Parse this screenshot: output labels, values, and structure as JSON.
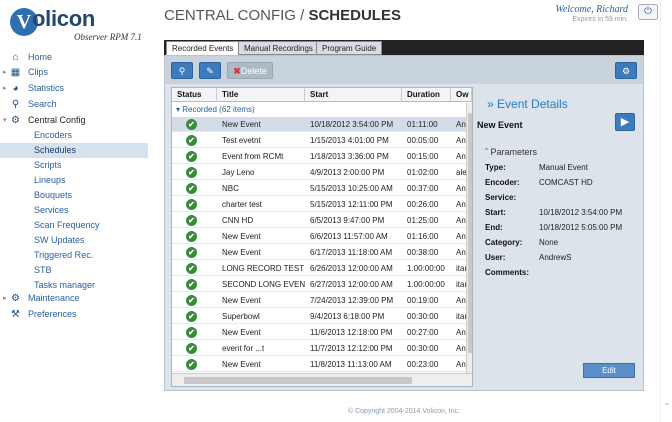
{
  "logo": {
    "word": "olicon",
    "letter": "V",
    "subtitle": "Observer RPM 7.1"
  },
  "header": {
    "title_prefix": "CENTRAL CONFIG / ",
    "title_bold": "SCHEDULES",
    "welcome": "Welcome, Richard",
    "expires": "Expires in 59 min."
  },
  "sidebar": {
    "items": [
      {
        "label": "Home",
        "icon": "home-icon"
      },
      {
        "label": "Clips",
        "icon": "clips-icon"
      },
      {
        "label": "Statistics",
        "icon": "statistics-icon"
      },
      {
        "label": "Search",
        "icon": "search-icon"
      },
      {
        "label": "Central Config",
        "icon": "gear-icon"
      }
    ],
    "subitems": [
      "Encoders",
      "Schedules",
      "Scripts",
      "Lineups",
      "Bouquets",
      "Services",
      "Scan Frequency",
      "SW Updates",
      "Triggered Rec.",
      "STB",
      "Tasks manager"
    ],
    "bottom": [
      {
        "label": "Maintenance",
        "icon": "maintenance-icon"
      },
      {
        "label": "Preferences",
        "icon": "wrench-icon"
      }
    ]
  },
  "tabs": [
    "Recorded Events",
    "Manual Recordings",
    "Program Guide"
  ],
  "toolbar": {
    "delete_label": "Delete"
  },
  "grid": {
    "headers": [
      "Status",
      "Title",
      "Start",
      "Duration",
      "Ow"
    ],
    "group_label": "Recorded (62 items)",
    "rows": [
      {
        "title": "New Event",
        "start": "10/18/2012 3:54:00 PM",
        "duration": "01:11:00",
        "owner": "An"
      },
      {
        "title": "Test evetnt",
        "start": "1/15/2013 4:01:00 PM",
        "duration": "00:05:00",
        "owner": "An"
      },
      {
        "title": "Event from RCMt",
        "start": "1/18/2013 3:36:00 PM",
        "duration": "00:15:00",
        "owner": "An"
      },
      {
        "title": "Jay Leno",
        "start": "4/9/2013 2:00:00 PM",
        "duration": "01:02:00",
        "owner": "ale"
      },
      {
        "title": "NBC",
        "start": "5/15/2013 10:25:00 AM",
        "duration": "00:37:00",
        "owner": "An"
      },
      {
        "title": "charter test",
        "start": "5/15/2013 12:11:00 PM",
        "duration": "00:26:00",
        "owner": "An"
      },
      {
        "title": "CNN HD",
        "start": "6/5/2013 9:47:00 PM",
        "duration": "01:25:00",
        "owner": "An"
      },
      {
        "title": "New Event",
        "start": "6/6/2013 11:57:00 AM",
        "duration": "01:16:00",
        "owner": "An"
      },
      {
        "title": "New Event",
        "start": "6/17/2013 11:18:00 AM",
        "duration": "00:38:00",
        "owner": "An"
      },
      {
        "title": "LONG RECORD TEST",
        "start": "6/26/2013 12:00:00 AM",
        "duration": "1.00:00:00",
        "owner": "itar"
      },
      {
        "title": "SECOND LONG EVENT",
        "start": "6/27/2013 12:00:00 AM",
        "duration": "1.00:00:00",
        "owner": "itar"
      },
      {
        "title": "New Event",
        "start": "7/24/2013 12:39:00 PM",
        "duration": "00:19:00",
        "owner": "An"
      },
      {
        "title": "Superbowl",
        "start": "9/4/2013 6:18:00 PM",
        "duration": "00:30:00",
        "owner": "itar"
      },
      {
        "title": "New Event",
        "start": "11/6/2013 12:18:00 PM",
        "duration": "00:27:00",
        "owner": "An"
      },
      {
        "title": "event for ...t",
        "start": "11/7/2013 12:12:00 PM",
        "duration": "00:30:00",
        "owner": "An"
      },
      {
        "title": "New Event",
        "start": "11/8/2013 11:13:00 AM",
        "duration": "00:23:00",
        "owner": "An"
      }
    ]
  },
  "details": {
    "title": "Event Details",
    "name": "New Event",
    "params_title": "Parameters",
    "params": [
      {
        "key": "Type:",
        "value": "Manual Event"
      },
      {
        "key": "Encoder:",
        "value": "COMCAST HD"
      },
      {
        "key": "Service:",
        "value": ""
      },
      {
        "key": "Start:",
        "value": "10/18/2012 3:54:00 PM"
      },
      {
        "key": "End:",
        "value": "10/18/2012 5:05:00 PM"
      },
      {
        "key": "Category:",
        "value": "None"
      },
      {
        "key": "User:",
        "value": "AndrewS"
      },
      {
        "key": "Comments:",
        "value": ""
      }
    ],
    "edit_label": "Edit"
  },
  "footer": "© Copyright 2004-2014 Volicon, Inc."
}
